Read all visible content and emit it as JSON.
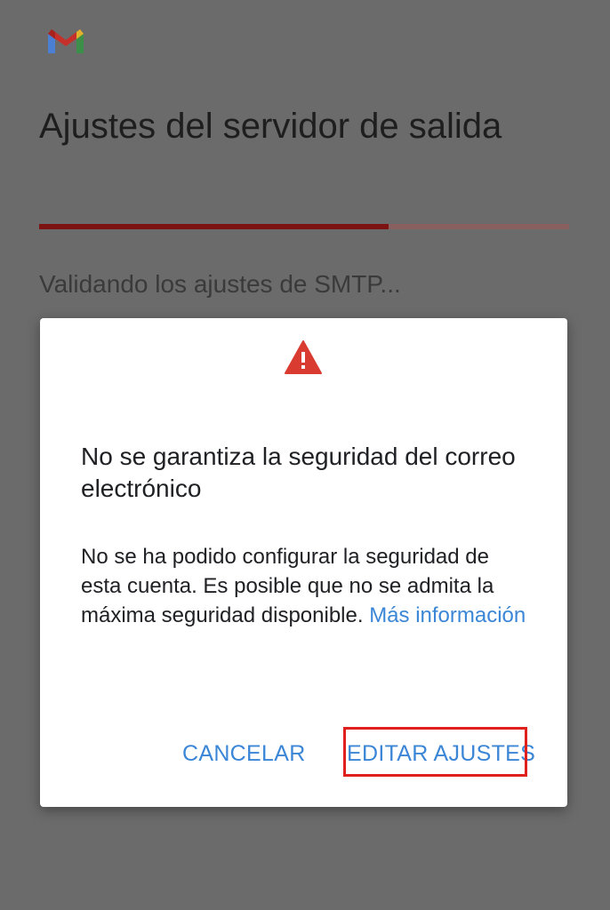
{
  "app": {
    "logo_icon": "gmail-logo-icon"
  },
  "page": {
    "title": "Ajustes del servidor de salida",
    "status": "Validando los ajustes de SMTP...",
    "progress_fraction": 0.66
  },
  "dialog": {
    "icon": "warning-triangle-icon",
    "title": "No se garantiza la seguridad del correo electrónico",
    "body": "No se ha podido configurar la seguridad de esta cuenta. Es posible que no se admita la máxima seguridad disponible.",
    "link": "Más información",
    "cancel_label": "CANCELAR",
    "edit_label": "EDITAR AJUSTES"
  },
  "colors": {
    "background_dim": "#6b6b6b",
    "progress_fill": "#7c1212",
    "warning_red": "#d93b30",
    "link_blue": "#3b86d6",
    "highlight_red": "#e0201c"
  }
}
